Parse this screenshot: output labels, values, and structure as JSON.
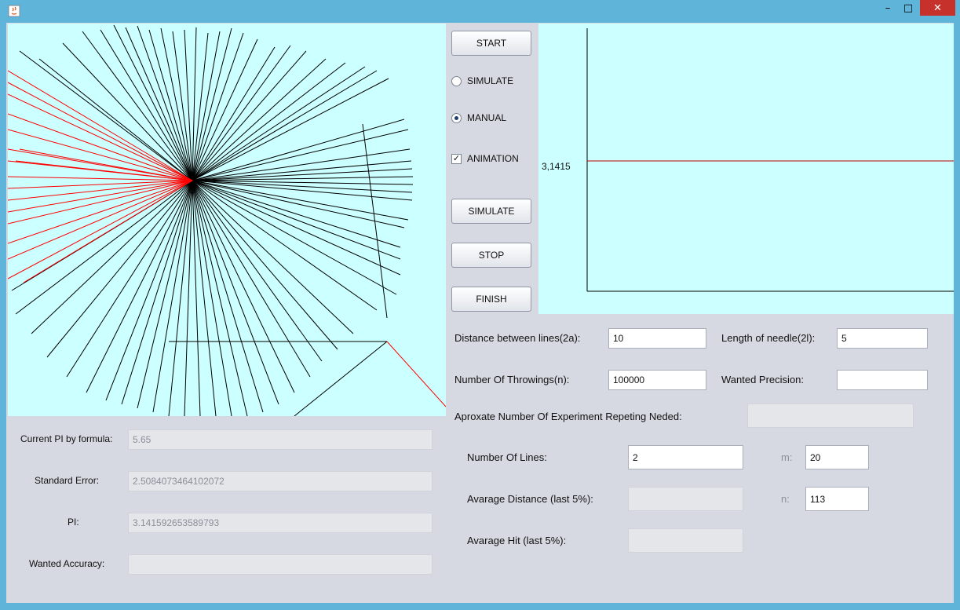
{
  "window": {
    "minimize_glyph": "–",
    "maximize_glyph": "□",
    "close_glyph": "✕"
  },
  "controls": {
    "start_label": "START",
    "simulate_radio_label": "SIMULATE",
    "simulate_radio_checked": false,
    "manual_radio_label": "MANUAL",
    "manual_radio_checked": true,
    "animation_label": "ANIMATION",
    "animation_checked": true,
    "checkmark": "✓",
    "simulate_button_label": "SIMULATE",
    "stop_label": "STOP",
    "finish_label": "FINISH"
  },
  "graph": {
    "y_value_label": "3,1415"
  },
  "stats": {
    "current_pi_label": "Current PI by formula:",
    "current_pi_value": "5.65",
    "standard_error_label": "Standard Error:",
    "standard_error_value": "2.5084073464102072",
    "pi_label": "PI:",
    "pi_value": "3.141592653589793",
    "wanted_accuracy_label": "Wanted Accuracy:",
    "wanted_accuracy_value": ""
  },
  "params": {
    "distance_label": "Distance between lines(2a):",
    "distance_value": "10",
    "needle_length_label": "Length of needle(2l):",
    "needle_length_value": "5",
    "throwings_label": "Number Of Throwings(n):",
    "throwings_value": "100000",
    "precision_label": "Wanted Precision:",
    "precision_value": "",
    "repeats_label": "Aproxate Number Of Experiment Repeting Neded:",
    "repeats_value": "",
    "lines_label": "Number Of Lines:",
    "lines_value": "2",
    "m_label": "m:",
    "m_value": "20",
    "avg_distance_label": "Avarage Distance  (last 5%):",
    "avg_distance_value": "",
    "n_label": "n:",
    "n_value": "113",
    "avg_hit_label": "Avarage Hit (last 5%):",
    "avg_hit_value": ""
  },
  "colors": {
    "canvas_bg": "#ccffff",
    "panel_bg": "#d6d9e1",
    "title_bar": "#5fb5d9",
    "hit_needle": "#ff0000",
    "miss_needle": "#000000",
    "close_button": "#c7312c"
  }
}
